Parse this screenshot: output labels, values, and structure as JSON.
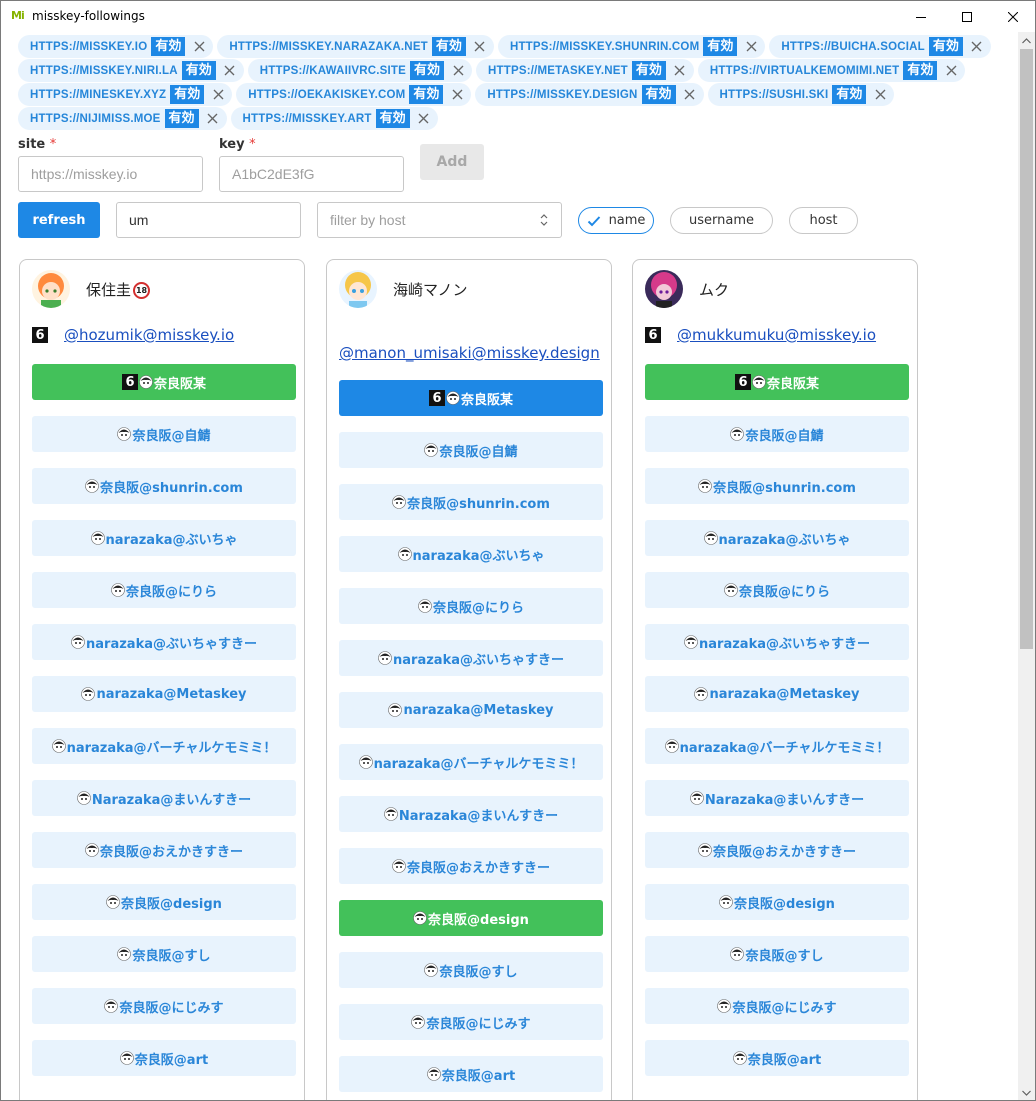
{
  "window": {
    "title": "misskey-followings",
    "app_icon": "Mi"
  },
  "colors": {
    "primary": "#1e88e5",
    "chip_bg": "#e8f3fd",
    "chip_text": "#2586d9",
    "active_green": "#43c15a",
    "required": "#e53935"
  },
  "hosts": [
    {
      "host": "HTTPS://MISSKEY.IO",
      "badge": "有効"
    },
    {
      "host": "HTTPS://MISSKEY.NARAZAKA.NET",
      "badge": "有効"
    },
    {
      "host": "HTTPS://MISSKEY.SHUNRIN.COM",
      "badge": "有効"
    },
    {
      "host": "HTTPS://BUICHA.SOCIAL",
      "badge": "有効"
    },
    {
      "host": "HTTPS://MISSKEY.NIRI.LA",
      "badge": "有効"
    },
    {
      "host": "HTTPS://KAWAIIVRC.SITE",
      "badge": "有効"
    },
    {
      "host": "HTTPS://METASKEY.NET",
      "badge": "有効"
    },
    {
      "host": "HTTPS://VIRTUALKEMOMIMI.NET",
      "badge": "有効"
    },
    {
      "host": "HTTPS://MINESKEY.XYZ",
      "badge": "有効"
    },
    {
      "host": "HTTPS://OEKAKISKEY.COM",
      "badge": "有効"
    },
    {
      "host": "HTTPS://MISSKEY.DESIGN",
      "badge": "有効"
    },
    {
      "host": "HTTPS://SUSHI.SKI",
      "badge": "有効"
    },
    {
      "host": "HTTPS://NIJIMISS.MOE",
      "badge": "有効"
    },
    {
      "host": "HTTPS://MISSKEY.ART",
      "badge": "有効"
    }
  ],
  "form": {
    "site_label": "site",
    "key_label": "key",
    "required_mark": "*",
    "site_placeholder": "https://misskey.io",
    "key_placeholder": "A1bC2dE3fG",
    "add_label": "Add"
  },
  "filters": {
    "refresh_label": "refresh",
    "search_value": "um",
    "host_placeholder": "filter by host",
    "toggles": [
      {
        "label": "name",
        "checked": true
      },
      {
        "label": "username",
        "checked": false
      },
      {
        "label": "host",
        "checked": false
      }
    ]
  },
  "cards": [
    {
      "name": "保住圭",
      "r18": "18",
      "acct": "@hozumik@misskey.io",
      "show_mk_icon": true,
      "buttons": [
        {
          "label": "奈良阪某",
          "style": "green",
          "mk": true
        },
        {
          "label": "奈良阪@自鯖",
          "style": "light"
        },
        {
          "label": "奈良阪@shunrin.com",
          "style": "light"
        },
        {
          "label": "narazaka@ぶいちゃ",
          "style": "light"
        },
        {
          "label": "奈良阪@にりら",
          "style": "light"
        },
        {
          "label": "narazaka@ぶいちゃすきー",
          "style": "light"
        },
        {
          "label": "narazaka@Metaskey",
          "style": "light"
        },
        {
          "label": "narazaka@バーチャルケモミミ！",
          "style": "light"
        },
        {
          "label": "Narazaka@まいんすきー",
          "style": "light"
        },
        {
          "label": "奈良阪@おえかきすきー",
          "style": "light"
        },
        {
          "label": "奈良阪@design",
          "style": "light"
        },
        {
          "label": "奈良阪@すし",
          "style": "light"
        },
        {
          "label": "奈良阪@にじみす",
          "style": "light"
        },
        {
          "label": "奈良阪@art",
          "style": "light"
        }
      ]
    },
    {
      "name": "海崎マノン",
      "r18": "",
      "acct": "@manon_umisaki@misskey.design",
      "show_mk_icon": false,
      "buttons": [
        {
          "label": "奈良阪某",
          "style": "blue",
          "mk": true
        },
        {
          "label": "奈良阪@自鯖",
          "style": "light"
        },
        {
          "label": "奈良阪@shunrin.com",
          "style": "light"
        },
        {
          "label": "narazaka@ぶいちゃ",
          "style": "light"
        },
        {
          "label": "奈良阪@にりら",
          "style": "light"
        },
        {
          "label": "narazaka@ぶいちゃすきー",
          "style": "light"
        },
        {
          "label": "narazaka@Metaskey",
          "style": "light"
        },
        {
          "label": "narazaka@バーチャルケモミミ！",
          "style": "light"
        },
        {
          "label": "Narazaka@まいんすきー",
          "style": "light"
        },
        {
          "label": "奈良阪@おえかきすきー",
          "style": "light"
        },
        {
          "label": "奈良阪@design",
          "style": "green"
        },
        {
          "label": "奈良阪@すし",
          "style": "light"
        },
        {
          "label": "奈良阪@にじみす",
          "style": "light"
        },
        {
          "label": "奈良阪@art",
          "style": "light"
        }
      ]
    },
    {
      "name": "ムク",
      "r18": "",
      "acct": "@mukkumuku@misskey.io",
      "show_mk_icon": true,
      "buttons": [
        {
          "label": "奈良阪某",
          "style": "green",
          "mk": true
        },
        {
          "label": "奈良阪@自鯖",
          "style": "light"
        },
        {
          "label": "奈良阪@shunrin.com",
          "style": "light"
        },
        {
          "label": "narazaka@ぶいちゃ",
          "style": "light"
        },
        {
          "label": "奈良阪@にりら",
          "style": "light"
        },
        {
          "label": "narazaka@ぶいちゃすきー",
          "style": "light"
        },
        {
          "label": "narazaka@Metaskey",
          "style": "light"
        },
        {
          "label": "narazaka@バーチャルケモミミ！",
          "style": "light"
        },
        {
          "label": "Narazaka@まいんすきー",
          "style": "light"
        },
        {
          "label": "奈良阪@おえかきすきー",
          "style": "light"
        },
        {
          "label": "奈良阪@design",
          "style": "light"
        },
        {
          "label": "奈良阪@すし",
          "style": "light"
        },
        {
          "label": "奈良阪@にじみす",
          "style": "light"
        },
        {
          "label": "奈良阪@art",
          "style": "light"
        }
      ]
    }
  ]
}
